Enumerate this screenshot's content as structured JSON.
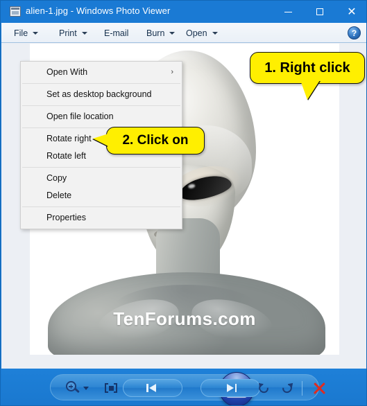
{
  "window": {
    "title": "alien-1.jpg - Windows Photo Viewer",
    "icon": "photo-viewer-icon",
    "controls": {
      "minimize": "minimize-icon",
      "maximize": "maximize-icon",
      "close": "close-icon"
    },
    "titlebar_color": "#1a7ad4"
  },
  "menubar": {
    "items": [
      {
        "label": "File",
        "has_dropdown": true
      },
      {
        "label": "Print",
        "has_dropdown": true
      },
      {
        "label": "E-mail",
        "has_dropdown": false
      },
      {
        "label": "Burn",
        "has_dropdown": true
      },
      {
        "label": "Open",
        "has_dropdown": true
      }
    ],
    "help_label": "?"
  },
  "image": {
    "watermark": "TenForums.com",
    "subject": "alien-bust-photo"
  },
  "context_menu": {
    "groups": [
      [
        {
          "label": "Open With",
          "submenu": true,
          "arrow": "›"
        }
      ],
      [
        {
          "label": "Set as desktop background",
          "submenu": false
        }
      ],
      [
        {
          "label": "Open file location",
          "submenu": false
        }
      ],
      [
        {
          "label": "Rotate right",
          "submenu": false
        },
        {
          "label": "Rotate left",
          "submenu": false
        }
      ],
      [
        {
          "label": "Copy",
          "submenu": false
        },
        {
          "label": "Delete",
          "submenu": false
        }
      ],
      [
        {
          "label": "Properties",
          "submenu": false
        }
      ]
    ]
  },
  "callouts": {
    "color": "#ffef00",
    "step1": "1. Right click",
    "step2": "2. Click on"
  },
  "toolbar": {
    "buttons": [
      {
        "name": "zoom",
        "label": "zoom-icon"
      },
      {
        "name": "fit-to-window",
        "label": "fit-to-window-icon"
      },
      {
        "name": "previous",
        "label": "previous-icon"
      },
      {
        "name": "play-slideshow",
        "label": "slideshow-icon"
      },
      {
        "name": "next",
        "label": "next-icon"
      },
      {
        "name": "rotate-counterclockwise",
        "label": "rotate-ccw-icon"
      },
      {
        "name": "rotate-clockwise",
        "label": "rotate-cw-icon"
      },
      {
        "name": "delete",
        "label": "delete-icon"
      }
    ]
  }
}
